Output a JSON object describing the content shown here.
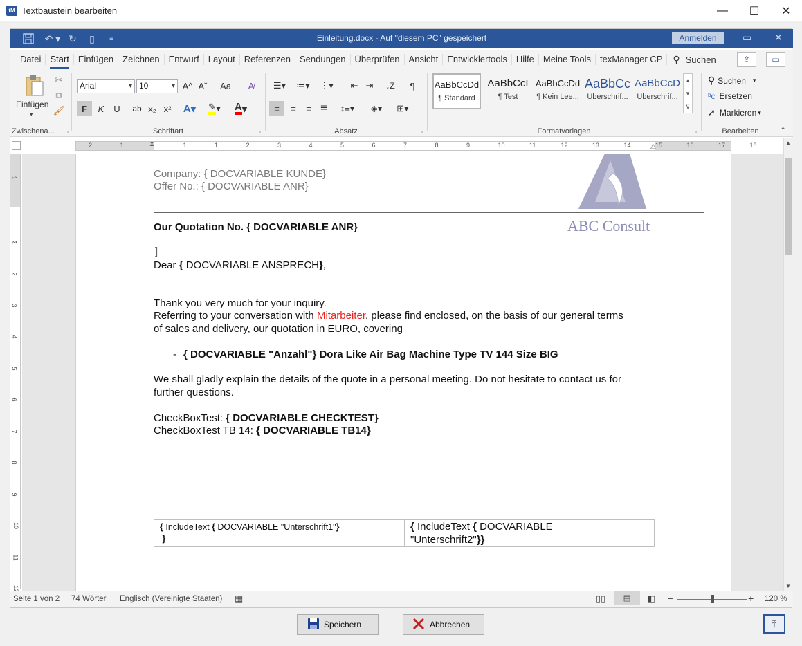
{
  "window": {
    "app_icon": "tM",
    "title": "Textbaustein bearbeiten",
    "min": "—",
    "max": "☐",
    "close": "✕"
  },
  "word": {
    "doc_title": "Einleitung.docx  -  Auf \"diesem PC\" gespeichert",
    "signin": "Anmelden",
    "tabs": [
      "Datei",
      "Start",
      "Einfügen",
      "Zeichnen",
      "Entwurf",
      "Layout",
      "Referenzen",
      "Sendungen",
      "Überprüfen",
      "Ansicht",
      "Entwicklertools",
      "Hilfe",
      "Meine Tools",
      "texManager CP"
    ],
    "active_tab": "Start",
    "search_label": "Suchen"
  },
  "ribbon": {
    "clipboard": {
      "paste_label": "Einfügen",
      "group_label": "Zwischena..."
    },
    "font": {
      "font_name": "Arial",
      "font_size": "10",
      "bold": "F",
      "italic": "K",
      "underline": "U",
      "strike": "ab",
      "sub": "x₂",
      "sup": "x²",
      "group_label": "Schriftart",
      "grow": "A^",
      "shrink": "Aˇ",
      "case": "Aa"
    },
    "paragraph": {
      "group_label": "Absatz"
    },
    "styles": {
      "group_label": "Formatvorlagen",
      "items": [
        {
          "preview": "AaBbCcDd",
          "name": "¶ Standard"
        },
        {
          "preview": "AaBbCcI",
          "name": "¶ Test"
        },
        {
          "preview": "AaBbCcDd",
          "name": "¶ Kein Lee..."
        },
        {
          "preview": "AaBbCc",
          "name": "Überschrif..."
        },
        {
          "preview": "AaBbCcD",
          "name": "Überschrif..."
        }
      ]
    },
    "editing": {
      "group_label": "Bearbeiten",
      "search": "Suchen",
      "replace": "Ersetzen",
      "select": "Markieren"
    }
  },
  "ruler": {
    "numbers": [
      "2",
      "1",
      "1",
      "1",
      "2",
      "3",
      "4",
      "5",
      "6",
      "7",
      "8",
      "9",
      "10",
      "11",
      "12",
      "13",
      "14",
      "15",
      "16",
      "17",
      "18"
    ],
    "vnumbers": [
      "1",
      "2",
      "1",
      "2",
      "3",
      "4",
      "5",
      "6",
      "7",
      "8",
      "9",
      "10",
      "11",
      "12"
    ]
  },
  "document": {
    "header_company_label": "Company: ",
    "header_company_field": "{ DOCVARIABLE KUNDE}",
    "header_offer_label": "Offer No.:  ",
    "header_offer_field": "{ DOCVARIABLE  ANR}",
    "logo_text": "ABC Consult",
    "quotation_label": "Our Quotation No. ",
    "quotation_field": "{ DOCVARIABLE  ANR}",
    "bracket_mark": "]",
    "dear": "Dear ",
    "dear_field_open": "{ ",
    "dear_field": "DOCVARIABLE  ANSPRECH",
    "dear_field_close": "}",
    "dear_comma": ",",
    "thanks": "Thank you very much for your inquiry.",
    "referring_pre": "Referring to your conversation with ",
    "referring_name": "Mitarbeiter",
    "referring_post": ", please find enclosed, on the basis of our general terms",
    "referring_line2": "of sales and delivery, our quotation in EURO, covering",
    "bullet_dash": "-",
    "bullet_text": "{ DOCVARIABLE  \"Anzahl\"} Dora Like Air Bag Machine Type TV 144 Size BIG",
    "explain_line1": "We shall gladly explain the details of the quote in a personal meeting. Do not hesitate to contact us for",
    "explain_line2": "further questions.",
    "checkbox1_label": "CheckBoxTest: ",
    "checkbox1_field": "{ DOCVARIABLE  CHECKTEST}",
    "checkbox2_label": "CheckBoxTest TB 14: ",
    "checkbox2_field": "{ DOCVARIABLE  TB14}",
    "sig1_open": "{ ",
    "sig1_mid": "IncludeText ",
    "sig1_open2": "{ ",
    "sig1_text": "DOCVARIABLE  \"Unterschrift1\"",
    "sig1_close2": "}",
    "sig1_close": "}",
    "sig2_open": "{ ",
    "sig2_mid": "IncludeText  ",
    "sig2_open2": "{ ",
    "sig2_text": "DOCVARIABLE",
    "sig2_text2": "\"Unterschrift2\"",
    "sig2_close": "}}"
  },
  "status": {
    "page": "Seite 1 von 2",
    "words": "74 Wörter",
    "language": "Englisch (Vereinigte Staaten)",
    "zoom": "120 %",
    "zoom_minus": "−",
    "zoom_plus": "+"
  },
  "dialog": {
    "save": "Speichern",
    "cancel": "Abbrechen"
  }
}
